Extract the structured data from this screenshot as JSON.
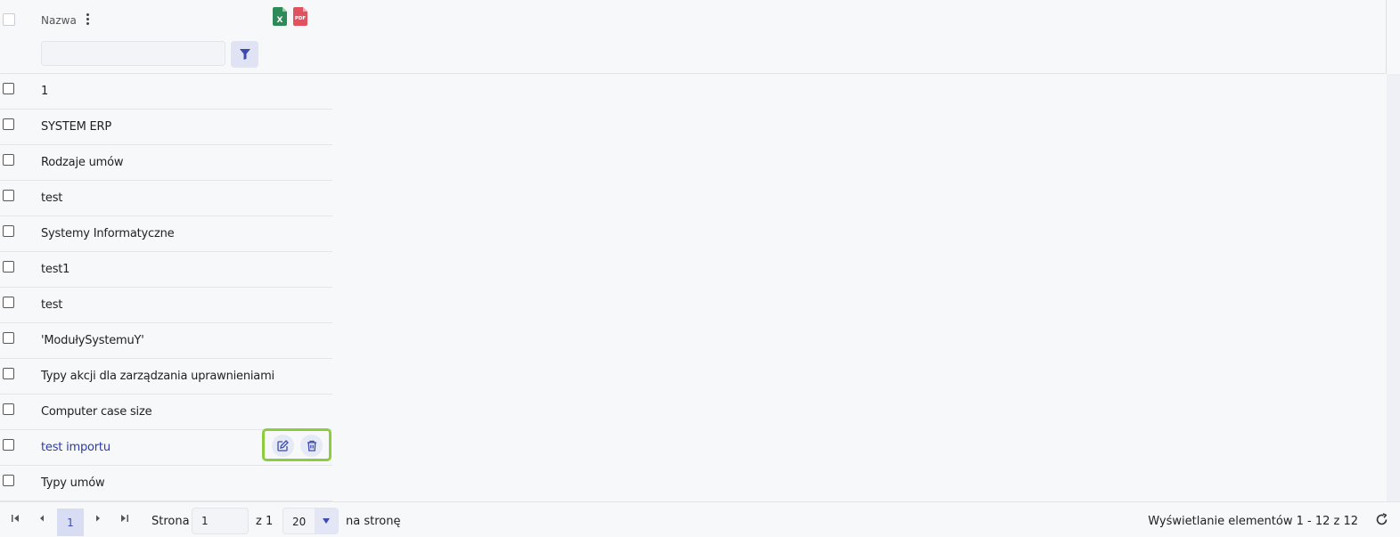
{
  "grid": {
    "column_title": "Nazwa",
    "filter_value": "",
    "rows": [
      {
        "label": "1"
      },
      {
        "label": "SYSTEM ERP"
      },
      {
        "label": "Rodzaje umów"
      },
      {
        "label": "test"
      },
      {
        "label": "Systemy Informatyczne"
      },
      {
        "label": "test1"
      },
      {
        "label": "test"
      },
      {
        "label": "'ModułySystemuY'"
      },
      {
        "label": "Typy akcji dla zarządzania uprawnieniami"
      },
      {
        "label": "Computer case size"
      },
      {
        "label": "test importu"
      },
      {
        "label": "Typy umów"
      }
    ]
  },
  "pager": {
    "current_page": "1",
    "page_label": "Strona",
    "page_input": "1",
    "of_label": "z 1",
    "page_size": "20",
    "per_page_label": "na stronę",
    "summary": "Wyświetlanie elementów 1 - 12 z 12"
  },
  "icons": {
    "kebab": "kebab-menu-icon",
    "excel": "excel-export-icon",
    "pdf": "pdf-export-icon",
    "filter": "filter-icon",
    "edit": "edit-icon",
    "delete": "trash-icon",
    "first": "first-page-icon",
    "prev": "prev-page-icon",
    "next": "next-page-icon",
    "last": "last-page-icon",
    "refresh": "refresh-icon"
  },
  "colors": {
    "accent": "#3d4ab0",
    "highlight_border": "#8ccc3e",
    "excel": "#2e8b57",
    "pdf": "#e05260"
  }
}
